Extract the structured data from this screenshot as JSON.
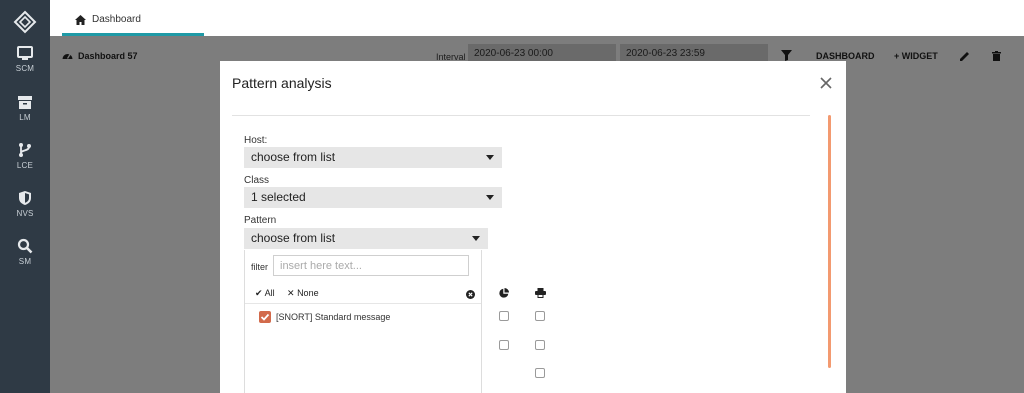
{
  "sidebar": {
    "items": [
      {
        "label": "SCM",
        "icon": "monitor-icon"
      },
      {
        "label": "LM",
        "icon": "archive-box-icon"
      },
      {
        "label": "LCE",
        "icon": "branch-icon"
      },
      {
        "label": "NVS",
        "icon": "shield-icon"
      },
      {
        "label": "SM",
        "icon": "search-icon"
      }
    ]
  },
  "topbar": {
    "tab_label": "Dashboard"
  },
  "toolbar": {
    "dashboard_title": "Dashboard 57",
    "interval_label": "Interval",
    "date_start": "2020-06-23 00:00",
    "date_end": "2020-06-23 23:59",
    "dashboard_btn": "DASHBOARD",
    "widget_btn": "WIDGET"
  },
  "modal": {
    "title": "Pattern analysis",
    "host_label": "Host:",
    "host_value": "choose from list",
    "class_label": "Class",
    "class_value": "1 selected",
    "pattern_label": "Pattern",
    "pattern_value": "choose from list",
    "filter_label": "filter",
    "filter_placeholder": "insert here text...",
    "all_label": "All",
    "none_label": "None",
    "items": [
      {
        "label": "[SNORT] Standard message",
        "checked": true
      }
    ]
  },
  "colors": {
    "sidebar_bg": "#2f3a45",
    "accent_tab": "#1f9aa6",
    "checkbox_checked": "#d26a4b",
    "scrollbar": "#f39a70"
  }
}
